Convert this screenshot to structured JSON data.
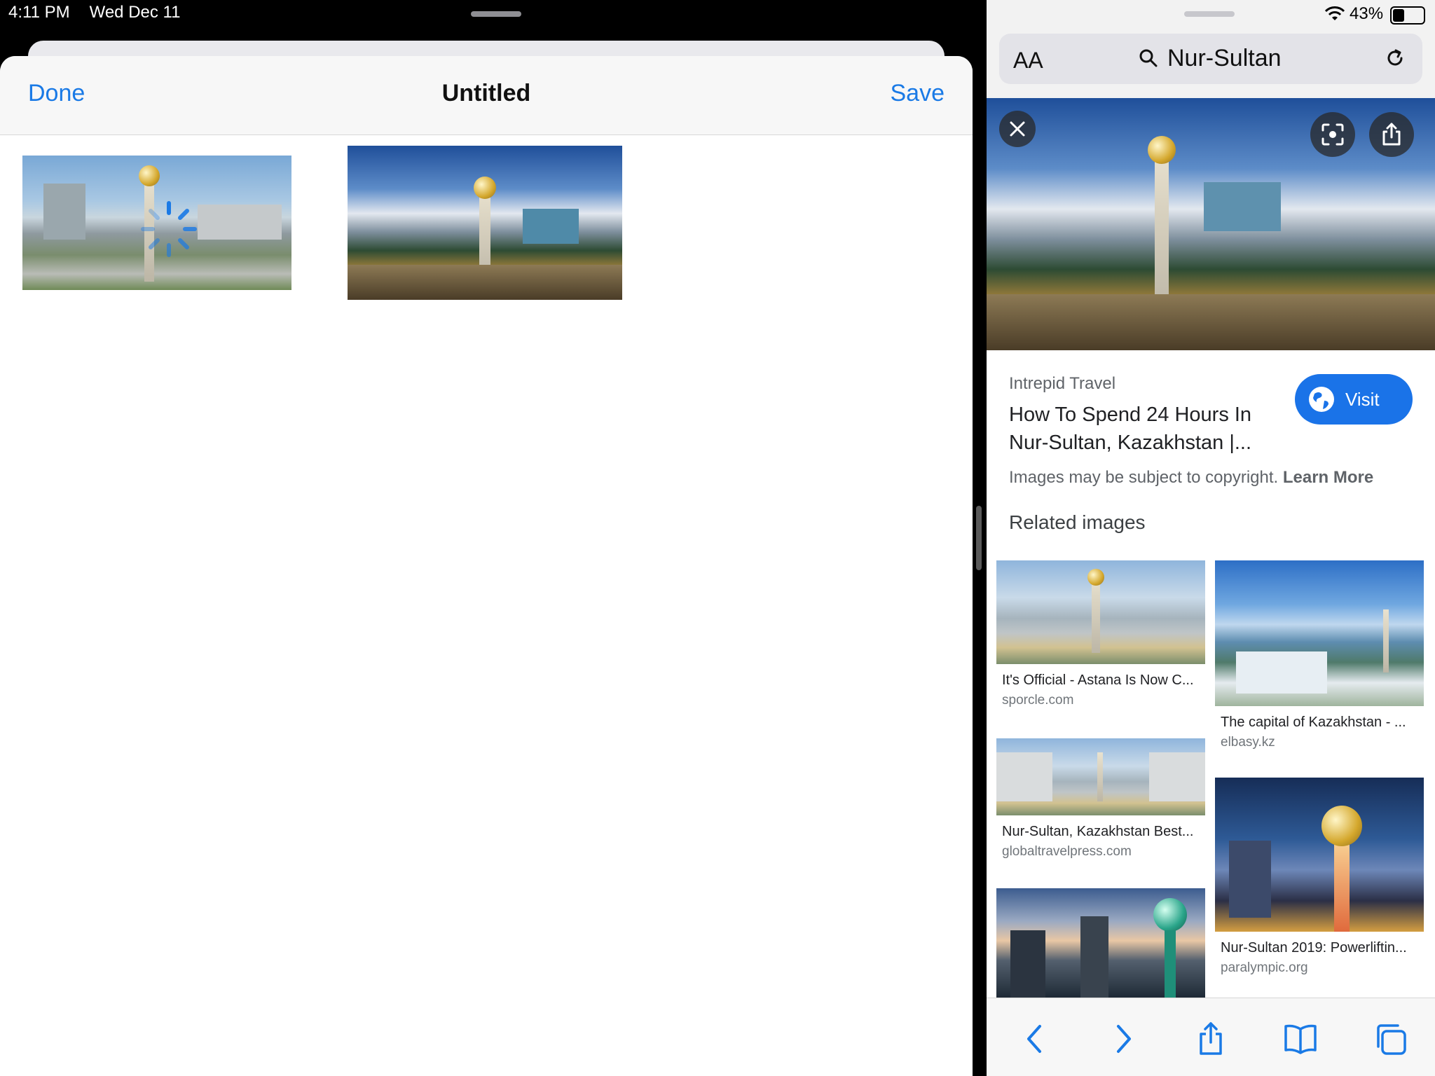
{
  "status": {
    "time": "4:11 PM",
    "date": "Wed Dec 11",
    "battery": "43%"
  },
  "note_app": {
    "done_label": "Done",
    "title": "Untitled",
    "save_label": "Save"
  },
  "browser": {
    "address_aa": "AA",
    "search_query": "Nur-Sultan",
    "result": {
      "source": "Intrepid Travel",
      "headline": "How To Spend 24 Hours In Nur-Sultan, Kazakhstan |...",
      "visit_label": "Visit",
      "copyright_text": "Images may be subject to copyright.",
      "learn_more": "Learn More"
    },
    "related_heading": "Related images",
    "related": [
      {
        "title": "It's Official - Astana Is Now C...",
        "domain": "sporcle.com"
      },
      {
        "title": "The capital of Kazakhstan - ...",
        "domain": "elbasy.kz"
      },
      {
        "title": "Nur-Sultan, Kazakhstan Best...",
        "domain": "globaltravelpress.com"
      },
      {
        "title": "Nur-Sultan 2019: Powerliftin...",
        "domain": "paralympic.org"
      }
    ],
    "toolbar_icons": [
      "back-icon",
      "forward-icon",
      "share-icon",
      "bookmarks-icon",
      "tabs-icon"
    ]
  },
  "colors": {
    "accent": "#1a7ae6",
    "visit_button": "#1a73e8"
  }
}
